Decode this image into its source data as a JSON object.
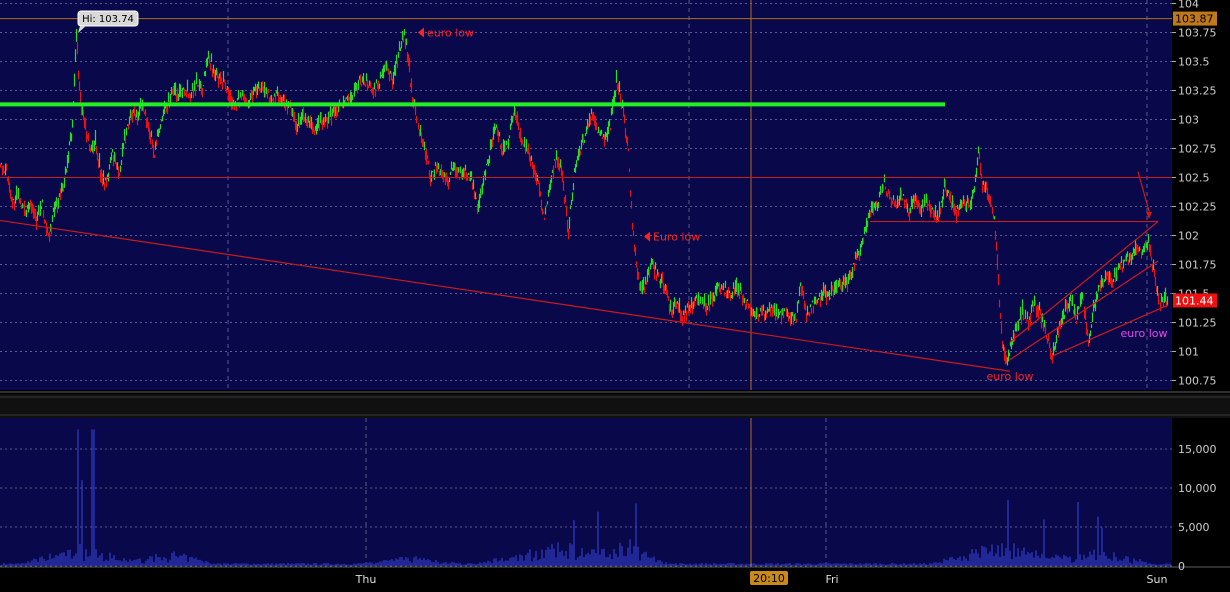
{
  "colors": {
    "background": "#08084a",
    "axis_background": "#000000",
    "grid": "#5a5a8a",
    "up_bar": "#22e022",
    "down_bar": "#ee1111",
    "annotation_line": "#cc1a1a",
    "support_line": "#22ee22",
    "volume": "#3a48e0",
    "annotation_text_red": "#ff2222",
    "annotation_text_magenta": "#ee44ee",
    "orange_line": "#b07018",
    "hi_label_bg": "#d8d8d8",
    "price_tag_last": "#ee1111",
    "price_tag_hi": "#c07818"
  },
  "chart_data": [
    {
      "type": "line",
      "panel": "price",
      "y_ticks": [
        "104",
        "103.75",
        "103.5",
        "103.25",
        "103",
        "102.75",
        "102.5",
        "102.25",
        "102",
        "101.75",
        "101.5",
        "101.25",
        "101",
        "100.75"
      ],
      "ylim": [
        100.7,
        104.05
      ],
      "x_day_labels": [
        "Thu",
        "Fri",
        "Sun"
      ],
      "crosshair_time_label": "20:10",
      "hi_label": "Hi: 103.74",
      "hi_value": 103.74,
      "price_tags": {
        "top": "103.87",
        "last": "101.44"
      },
      "level_lines": [
        103.87,
        102.5
      ],
      "support_line": {
        "level": 103.13
      },
      "annotations": [
        {
          "text": "euro low",
          "value": 103.75,
          "color": "red",
          "arrow": "left"
        },
        {
          "text": "Euro low",
          "value": 101.99,
          "color": "red",
          "arrow": "left"
        },
        {
          "text": "euro low",
          "value": 100.79,
          "color": "red",
          "arrow": "none"
        },
        {
          "text": "euro low",
          "value": 101.16,
          "color": "magenta",
          "arrow": "none"
        }
      ],
      "price_path": [
        [
          0,
          102.62
        ],
        [
          6,
          102.55
        ],
        [
          12,
          102.28
        ],
        [
          18,
          102.35
        ],
        [
          24,
          102.2
        ],
        [
          30,
          102.3
        ],
        [
          36,
          102.15
        ],
        [
          42,
          102.25
        ],
        [
          48,
          101.97
        ],
        [
          54,
          102.22
        ],
        [
          60,
          102.35
        ],
        [
          66,
          102.55
        ],
        [
          72,
          102.95
        ],
        [
          76,
          103.74
        ],
        [
          80,
          103.15
        ],
        [
          85,
          102.95
        ],
        [
          90,
          102.72
        ],
        [
          95,
          102.82
        ],
        [
          100,
          102.55
        ],
        [
          106,
          102.45
        ],
        [
          112,
          102.72
        ],
        [
          118,
          102.52
        ],
        [
          124,
          102.82
        ],
        [
          130,
          103.05
        ],
        [
          136,
          103.02
        ],
        [
          142,
          103.12
        ],
        [
          148,
          102.92
        ],
        [
          154,
          102.72
        ],
        [
          160,
          102.95
        ],
        [
          166,
          103.12
        ],
        [
          172,
          103.25
        ],
        [
          178,
          103.22
        ],
        [
          184,
          103.28
        ],
        [
          190,
          103.22
        ],
        [
          196,
          103.32
        ],
        [
          202,
          103.28
        ],
        [
          208,
          103.55
        ],
        [
          212,
          103.45
        ],
        [
          218,
          103.32
        ],
        [
          224,
          103.32
        ],
        [
          230,
          103.18
        ],
        [
          236,
          103.15
        ],
        [
          242,
          103.2
        ],
        [
          248,
          103.15
        ],
        [
          254,
          103.25
        ],
        [
          260,
          103.28
        ],
        [
          266,
          103.25
        ],
        [
          272,
          103.15
        ],
        [
          278,
          103.22
        ],
        [
          284,
          103.15
        ],
        [
          290,
          103.1
        ],
        [
          296,
          102.92
        ],
        [
          302,
          103.02
        ],
        [
          308,
          102.97
        ],
        [
          314,
          102.9
        ],
        [
          320,
          103.0
        ],
        [
          326,
          102.97
        ],
        [
          332,
          103.05
        ],
        [
          338,
          103.12
        ],
        [
          344,
          103.15
        ],
        [
          350,
          103.18
        ],
        [
          356,
          103.28
        ],
        [
          362,
          103.35
        ],
        [
          368,
          103.3
        ],
        [
          374,
          103.25
        ],
        [
          380,
          103.35
        ],
        [
          386,
          103.45
        ],
        [
          392,
          103.35
        ],
        [
          398,
          103.55
        ],
        [
          404,
          103.74
        ],
        [
          408,
          103.5
        ],
        [
          412,
          103.2
        ],
        [
          418,
          102.95
        ],
        [
          424,
          102.75
        ],
        [
          430,
          102.5
        ],
        [
          436,
          102.6
        ],
        [
          442,
          102.52
        ],
        [
          448,
          102.48
        ],
        [
          454,
          102.6
        ],
        [
          460,
          102.52
        ],
        [
          466,
          102.55
        ],
        [
          472,
          102.45
        ],
        [
          478,
          102.25
        ],
        [
          484,
          102.52
        ],
        [
          490,
          102.75
        ],
        [
          496,
          102.92
        ],
        [
          502,
          102.72
        ],
        [
          508,
          102.82
        ],
        [
          514,
          103.1
        ],
        [
          520,
          102.85
        ],
        [
          526,
          102.75
        ],
        [
          532,
          102.62
        ],
        [
          538,
          102.45
        ],
        [
          544,
          102.15
        ],
        [
          550,
          102.45
        ],
        [
          556,
          102.7
        ],
        [
          562,
          102.5
        ],
        [
          568,
          102.05
        ],
        [
          574,
          102.55
        ],
        [
          580,
          102.75
        ],
        [
          586,
          102.9
        ],
        [
          592,
          103.05
        ],
        [
          598,
          102.9
        ],
        [
          604,
          102.85
        ],
        [
          610,
          102.95
        ],
        [
          616,
          103.35
        ],
        [
          622,
          103.12
        ],
        [
          628,
          102.72
        ],
        [
          632,
          102.1
        ],
        [
          636,
          101.72
        ],
        [
          640,
          101.55
        ],
        [
          646,
          101.62
        ],
        [
          652,
          101.75
        ],
        [
          658,
          101.65
        ],
        [
          664,
          101.55
        ],
        [
          670,
          101.35
        ],
        [
          676,
          101.42
        ],
        [
          682,
          101.3
        ],
        [
          688,
          101.38
        ],
        [
          694,
          101.42
        ],
        [
          700,
          101.45
        ],
        [
          706,
          101.38
        ],
        [
          712,
          101.48
        ],
        [
          718,
          101.55
        ],
        [
          724,
          101.52
        ],
        [
          730,
          101.48
        ],
        [
          736,
          101.58
        ],
        [
          742,
          101.45
        ],
        [
          748,
          101.4
        ],
        [
          754,
          101.32
        ],
        [
          760,
          101.35
        ],
        [
          766,
          101.3
        ],
        [
          772,
          101.38
        ],
        [
          778,
          101.3
        ],
        [
          784,
          101.35
        ],
        [
          790,
          101.3
        ],
        [
          796,
          101.28
        ],
        [
          800,
          101.55
        ],
        [
          806,
          101.32
        ],
        [
          812,
          101.4
        ],
        [
          818,
          101.45
        ],
        [
          824,
          101.52
        ],
        [
          830,
          101.48
        ],
        [
          836,
          101.58
        ],
        [
          842,
          101.55
        ],
        [
          848,
          101.62
        ],
        [
          854,
          101.75
        ],
        [
          860,
          101.9
        ],
        [
          866,
          102.1
        ],
        [
          872,
          102.25
        ],
        [
          878,
          102.3
        ],
        [
          884,
          102.45
        ],
        [
          890,
          102.32
        ],
        [
          896,
          102.25
        ],
        [
          902,
          102.35
        ],
        [
          908,
          102.2
        ],
        [
          914,
          102.3
        ],
        [
          920,
          102.22
        ],
        [
          926,
          102.28
        ],
        [
          932,
          102.2
        ],
        [
          938,
          102.15
        ],
        [
          944,
          102.42
        ],
        [
          950,
          102.3
        ],
        [
          956,
          102.2
        ],
        [
          962,
          102.3
        ],
        [
          968,
          102.25
        ],
        [
          974,
          102.38
        ],
        [
          978,
          102.75
        ],
        [
          982,
          102.45
        ],
        [
          988,
          102.35
        ],
        [
          994,
          102.15
        ],
        [
          998,
          101.62
        ],
        [
          1002,
          101.05
        ],
        [
          1006,
          100.9
        ],
        [
          1010,
          101.05
        ],
        [
          1016,
          101.2
        ],
        [
          1022,
          101.35
        ],
        [
          1028,
          101.25
        ],
        [
          1034,
          101.45
        ],
        [
          1040,
          101.3
        ],
        [
          1046,
          101.15
        ],
        [
          1052,
          100.95
        ],
        [
          1058,
          101.2
        ],
        [
          1064,
          101.35
        ],
        [
          1070,
          101.45
        ],
        [
          1076,
          101.3
        ],
        [
          1082,
          101.5
        ],
        [
          1088,
          101.08
        ],
        [
          1094,
          101.42
        ],
        [
          1100,
          101.55
        ],
        [
          1106,
          101.65
        ],
        [
          1112,
          101.6
        ],
        [
          1118,
          101.7
        ],
        [
          1124,
          101.78
        ],
        [
          1130,
          101.82
        ],
        [
          1136,
          101.9
        ],
        [
          1142,
          101.85
        ],
        [
          1148,
          101.95
        ],
        [
          1152,
          101.75
        ],
        [
          1156,
          101.52
        ],
        [
          1160,
          101.4
        ],
        [
          1164,
          101.48
        ],
        [
          1168,
          101.44
        ]
      ],
      "trendlines": [
        {
          "from": [
            0,
            102.13
          ],
          "to": [
            1010,
            100.83
          ]
        },
        {
          "from": [
            870,
            102.12
          ],
          "to": [
            1158,
            102.12
          ]
        },
        {
          "from": [
            1010,
            101.08
          ],
          "to": [
            1158,
            102.12
          ]
        },
        {
          "from": [
            1010,
            100.93
          ],
          "to": [
            1158,
            101.78
          ]
        },
        {
          "from": [
            1052,
            100.96
          ],
          "to": [
            1168,
            101.4
          ]
        },
        {
          "from": [
            1138,
            102.55
          ],
          "to": [
            1150,
            102.18
          ]
        }
      ]
    },
    {
      "type": "bar",
      "panel": "volume",
      "y_ticks": [
        "15,000",
        "10,000",
        "5,000",
        "0"
      ],
      "ylim": [
        0,
        17500
      ],
      "bursts": [
        {
          "center": 80,
          "width": 60,
          "peak": 17500,
          "base": 1600
        },
        {
          "center": 170,
          "width": 50,
          "peak": 9500,
          "base": 1000
        },
        {
          "center": 410,
          "width": 50,
          "peak": 3200,
          "base": 700
        },
        {
          "center": 565,
          "width": 90,
          "peak": 8500,
          "base": 1800
        },
        {
          "center": 630,
          "width": 40,
          "peak": 12500,
          "base": 1500
        },
        {
          "center": 1000,
          "width": 70,
          "peak": 9500,
          "base": 2000
        },
        {
          "center": 1095,
          "width": 60,
          "peak": 7500,
          "base": 1200
        }
      ]
    }
  ]
}
